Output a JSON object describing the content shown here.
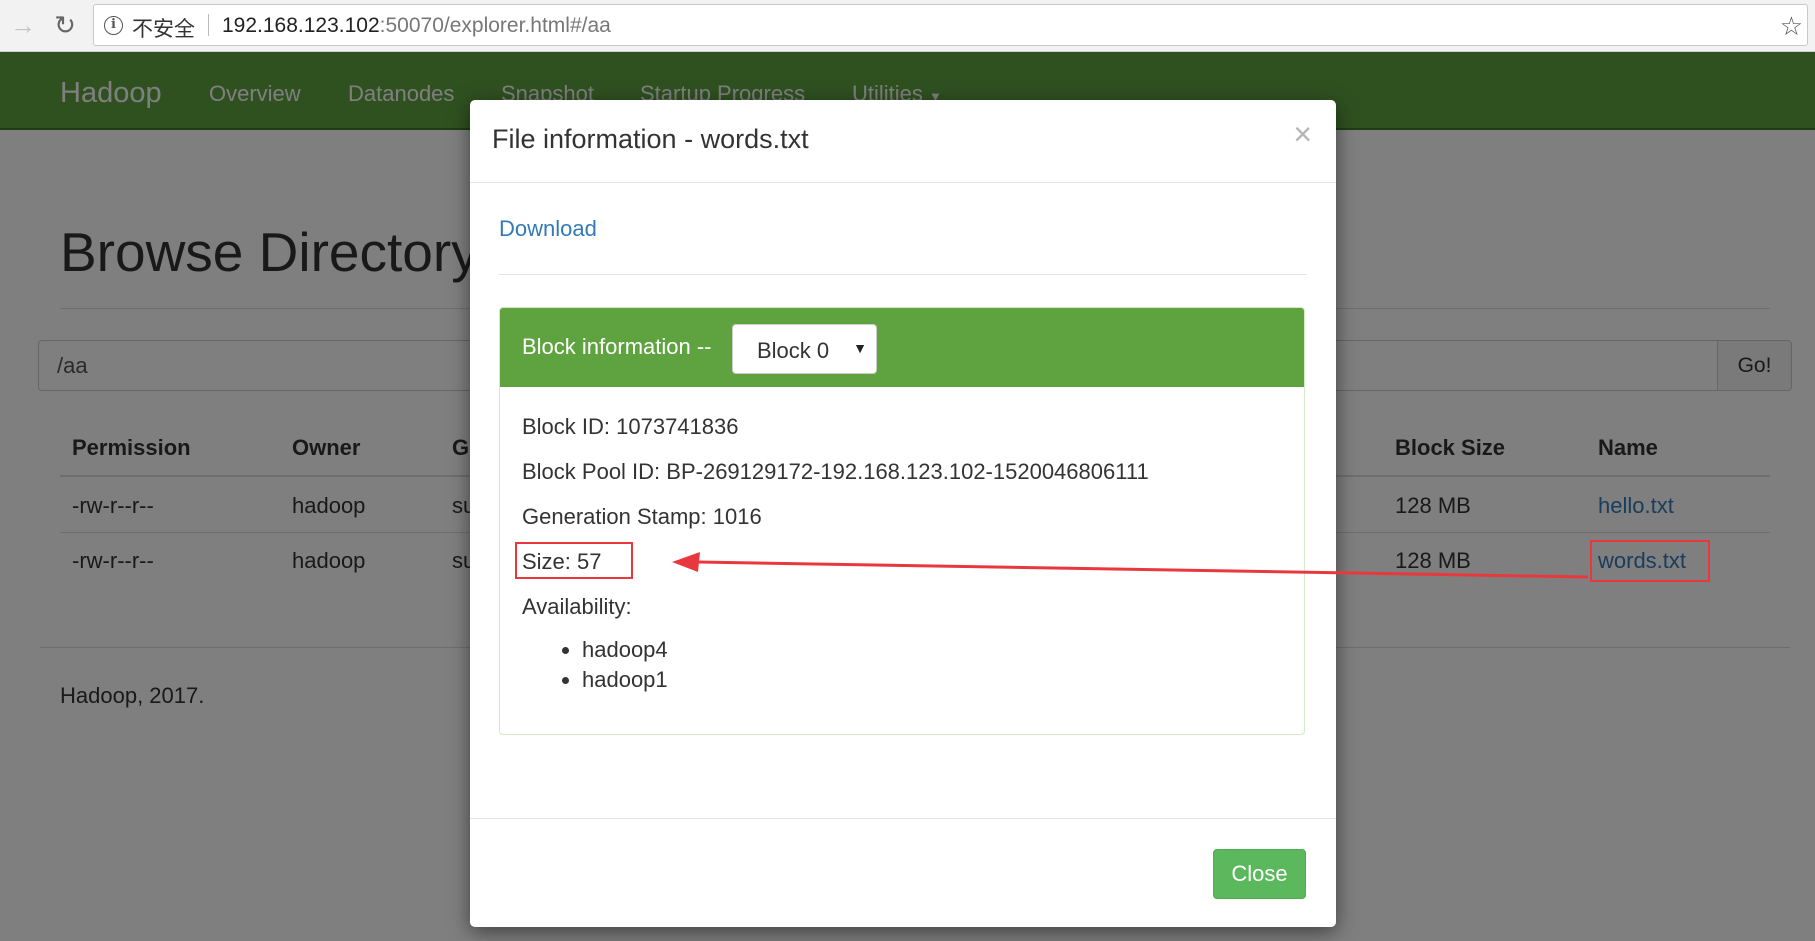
{
  "browser": {
    "security_label": "不安全",
    "url_host": "192.168.123.102",
    "url_rest": ":50070/explorer.html#/aa"
  },
  "navbar": {
    "brand": "Hadoop",
    "links": [
      "Overview",
      "Datanodes",
      "Snapshot",
      "Startup Progress",
      "Utilities"
    ]
  },
  "page": {
    "title": "Browse Directory",
    "path_value": "/aa",
    "go_label": "Go!",
    "table": {
      "headers": [
        "Permission",
        "Owner",
        "G",
        "Block Size",
        "Name"
      ],
      "rows": [
        [
          "-rw-r--r--",
          "hadoop",
          "su",
          "128 MB",
          "hello.txt"
        ],
        [
          "-rw-r--r--",
          "hadoop",
          "su",
          "128 MB",
          "words.txt"
        ]
      ]
    },
    "footer": "Hadoop, 2017."
  },
  "modal": {
    "title": "File information - words.txt",
    "close_symbol": "×",
    "download_label": "Download",
    "block_heading": "Block information --",
    "block_selected": "Block 0",
    "block_id": "Block ID: 1073741836",
    "block_pool_id": "Block Pool ID: BP-269129172-192.168.123.102-1520046806111",
    "generation_stamp": "Generation Stamp: 1016",
    "size": "Size: 57",
    "availability_label": "Availability:",
    "availability": [
      "hadoop4",
      "hadoop1"
    ],
    "close_label": "Close"
  },
  "colors": {
    "navbar_green": "#5fa341",
    "link_blue": "#337ab7",
    "button_green": "#5cb85c",
    "annotation_red": "#e8383d"
  }
}
